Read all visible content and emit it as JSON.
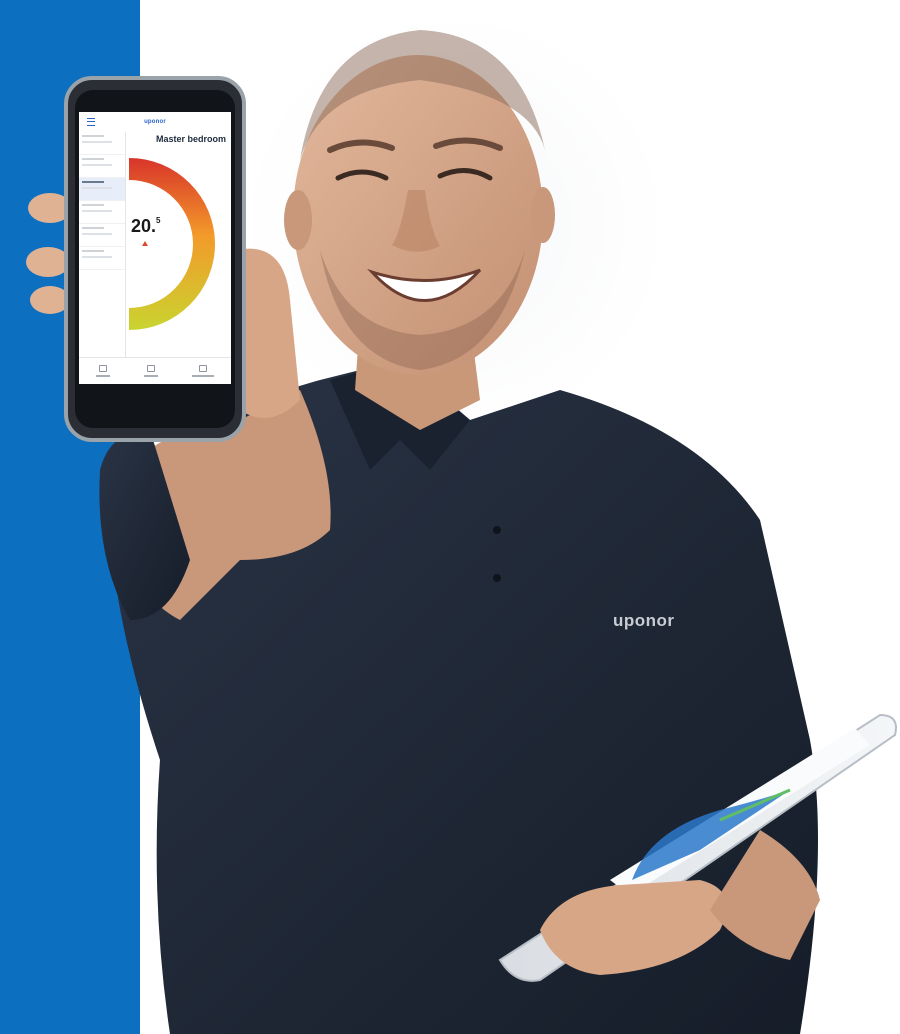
{
  "brand": {
    "shirt_logo": "uponor",
    "app_logo": "uponor"
  },
  "phone_app": {
    "room_title": "Master bedroom",
    "room_subtitle": "",
    "temperature": "20.",
    "temperature_decimal": "5",
    "arrow_icon": "arrow-up-icon",
    "rooms_count_visible": 6
  },
  "colors": {
    "band": "#0c6fc0",
    "shirt": "#1f2937",
    "gauge_start": "#d8342a",
    "gauge_mid": "#f39a2a",
    "gauge_end": "#c9d430",
    "app_accent": "#2c63c9"
  }
}
